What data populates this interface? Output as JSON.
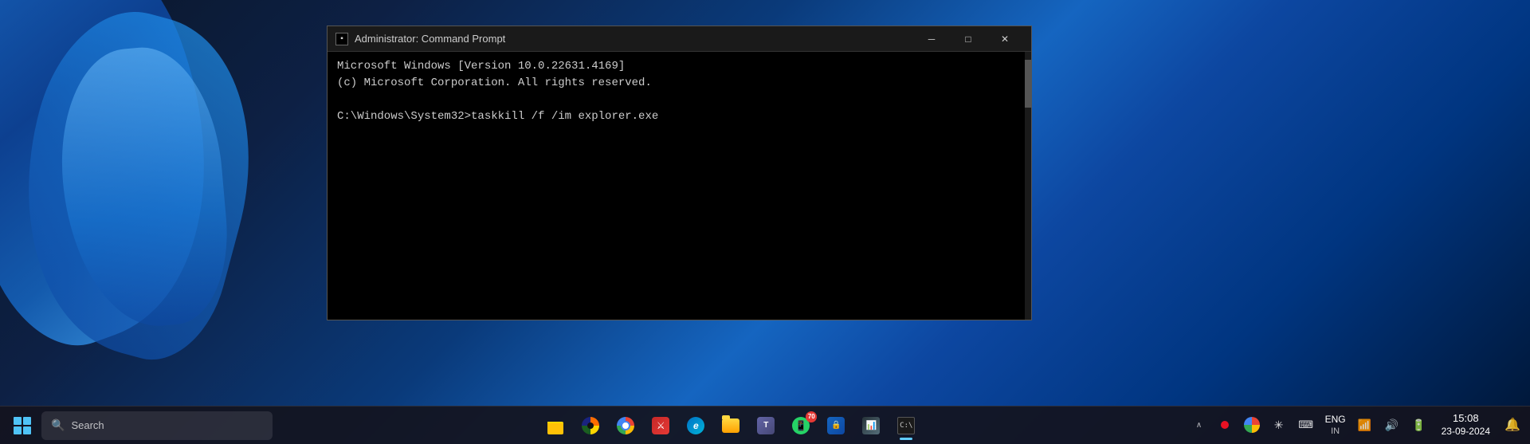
{
  "desktop": {
    "background_description": "Windows 11 blue swirl wallpaper"
  },
  "cmd_window": {
    "title": "Administrator: Command Prompt",
    "line1": "Microsoft Windows [Version 10.0.22631.4169]",
    "line2": "(c) Microsoft Corporation. All rights reserved.",
    "line3": "",
    "line4": "C:\\Windows\\System32>taskkill /f /im explorer.exe",
    "controls": {
      "minimize": "─",
      "maximize": "□",
      "close": "✕"
    }
  },
  "taskbar": {
    "search_placeholder": "Search",
    "apps": [
      {
        "name": "file-explorer",
        "label": "File Explorer",
        "active": false
      },
      {
        "name": "chrome-canary",
        "label": "Google Chrome Canary",
        "active": false
      },
      {
        "name": "chrome",
        "label": "Google Chrome",
        "active": false
      },
      {
        "name": "game",
        "label": "Game/Red App",
        "active": false
      },
      {
        "name": "edge",
        "label": "Microsoft Edge",
        "active": false
      },
      {
        "name": "files",
        "label": "Files",
        "active": false
      },
      {
        "name": "teams",
        "label": "Microsoft Teams",
        "active": false
      },
      {
        "name": "whatsapp",
        "label": "WhatsApp",
        "active": false
      },
      {
        "name": "vpn",
        "label": "VPN/Security",
        "active": false
      },
      {
        "name": "monitor",
        "label": "Network Monitor",
        "active": false
      },
      {
        "name": "cmd",
        "label": "Command Prompt",
        "active": true
      }
    ]
  },
  "system_tray": {
    "overflow_label": "^",
    "red_dot": "",
    "tray_google": "",
    "network_icon": "⊕",
    "wifi_icon": "📶",
    "volume_icon": "🔊",
    "battery_icon": "🔋",
    "lang": "ENG",
    "lang_sub": "IN",
    "time": "15:08",
    "date": "23-09-2024",
    "notification_icon": "🔔"
  }
}
